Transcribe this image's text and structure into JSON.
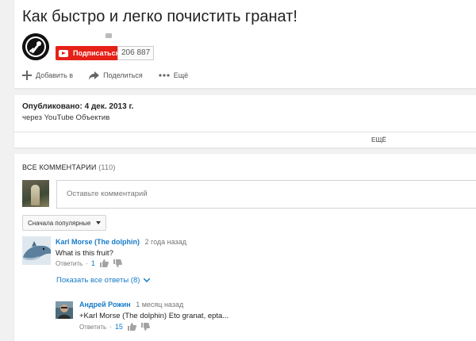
{
  "video": {
    "title": "Как быстро и легко почистить гранат!",
    "subscribe_label": "Подписаться",
    "subscriber_count": "206 887"
  },
  "actions": {
    "add_label": "Добавить в",
    "share_label": "Поделиться",
    "more_label": "Ещё"
  },
  "description": {
    "published": "Опубликовано: 4 дек. 2013 г.",
    "via": "через YouTube Объектив",
    "more_label": "ЕЩЁ"
  },
  "comments": {
    "heading": "ВСЕ КОММЕНТАРИИ",
    "count": "(110)",
    "input_placeholder": "Оставьте комментарий",
    "sort_label": "Сначала популярные",
    "items": [
      {
        "author": "Karl Morse (The dolphin)",
        "time": "2 года назад",
        "text": "What is this fruit?",
        "reply_label": "Ответить",
        "likes": "1"
      },
      {
        "author": "Андрей Рожин",
        "time": "1 месяц назад",
        "text": "+Karl Morse (The dolphin) Eto granat, epta...",
        "reply_label": "Ответить",
        "likes": "15"
      }
    ],
    "show_replies_label": "Показать все ответы (8)"
  },
  "colors": {
    "brand_red": "#e62117",
    "link_blue": "#167ac6"
  }
}
